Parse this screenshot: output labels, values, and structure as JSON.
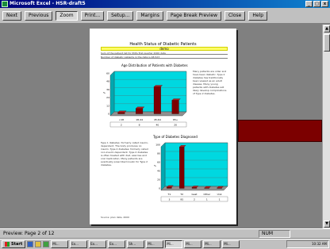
{
  "window": {
    "title": "Microsoft Excel - HSR-draft5",
    "min": "_",
    "max": "□",
    "close": "x"
  },
  "toolbar": {
    "buttons": [
      "Next",
      "Previous",
      "Zoom",
      "Print...",
      "Setup...",
      "Margins",
      "Page Break Preview",
      "Close",
      "Help"
    ]
  },
  "page": {
    "title": "Health Status of Diabetic Patients",
    "subtitle": "demo",
    "notes": [
      "Sum of the patient list for PCPs first quarter 2000 data",
      "Number of diabetic patients in the data is 48,523"
    ],
    "chart1": {
      "title": "Age Distribution of Patients with Diabetes",
      "side_text": "Many patients are older and have been diabetic. Type 2 diabetes has traditionally been viewed as an adult disease. Many young patients with diabetes will likely develop complications of Type 2 diabetes."
    },
    "chart2": {
      "title": "Type of Diabetes Diagnosed",
      "side_text": "Type 1 diabetes: formerly called insulin-dependent. The body produces no insulin. Type 2 diabetes: formerly called non-insulin dependent. Type 2 diabetes is often treated with diet, exercise and oral medication. Many patients are eventually prescribed insulin for Type 2 diabetes."
    },
    "footer": "Source: plan data, 2000"
  },
  "chart_data": [
    {
      "type": "bar",
      "title": "Age Distribution of Patients with Diabetes",
      "categories": [
        "<18",
        "18-44",
        "45-64",
        "65+"
      ],
      "values": [
        2,
        8,
        40,
        20
      ],
      "ylim": [
        0,
        60
      ],
      "ylabel": "%",
      "grid": true
    },
    {
      "type": "bar",
      "title": "Type of Diabetes Diagnosed",
      "categories": [
        "T1",
        "T2",
        "Gest",
        "Other",
        "Unk"
      ],
      "values": [
        3,
        95,
        2,
        1,
        1
      ],
      "ylim": [
        0,
        100
      ],
      "ylabel": "%",
      "grid": true
    }
  ],
  "status": {
    "text": "Preview: Page 2 of 12",
    "num": "NUM"
  },
  "taskbar": {
    "start": "Start",
    "items": [
      "Mi...",
      "Ex...",
      "Ex...",
      "Ex...",
      "Sh...",
      "Mi...",
      "Mi...",
      "Mi...",
      "Mi...",
      "Mi..."
    ],
    "clock": "10:32 AM"
  },
  "colors": {
    "bar": "#7c0000",
    "plot_bg": "#00d8e0",
    "title_bar": "#00007b",
    "highlight": "#ffff66"
  }
}
